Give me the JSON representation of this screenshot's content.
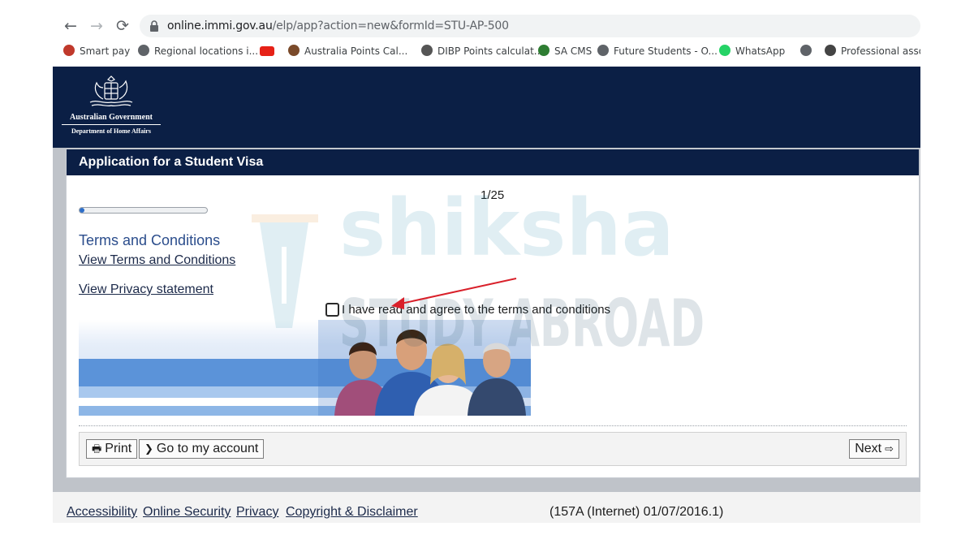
{
  "browser": {
    "url_host": "online.immi.gov.au",
    "url_rest": "/elp/app?action=new&formId=STU-AP-500",
    "back_glyph": "←",
    "forward_glyph": "→",
    "reload_glyph": "⟳",
    "bookmarks": [
      {
        "label": "Smart pay",
        "icon": "smart-pay-icon",
        "color": "#c0392b"
      },
      {
        "label": "Regional locations i...",
        "icon": "globe-icon",
        "color": "#5f6368"
      },
      {
        "label": "",
        "icon": "youtube-icon",
        "color": "#e62117"
      },
      {
        "label": "Australia Points Cal...",
        "icon": "points-calculator-icon",
        "color": "#7a4a2a"
      },
      {
        "label": "DIBP Points calculat...",
        "icon": "dibp-crest-icon",
        "color": "#555555"
      },
      {
        "label": "SA CMS",
        "icon": "sa-cms-icon",
        "color": "#2e7d32"
      },
      {
        "label": "Future Students - O...",
        "icon": "globe-icon",
        "color": "#5f6368"
      },
      {
        "label": "WhatsApp",
        "icon": "whatsapp-icon",
        "color": "#25d366"
      },
      {
        "label": "",
        "icon": "globe-icon",
        "color": "#5f6368"
      },
      {
        "label": "Professional assoc",
        "icon": "shield-crest-icon",
        "color": "#444444"
      }
    ]
  },
  "header": {
    "line1": "Australian Government",
    "line2": "Department of Home Affairs",
    "bg_color": "#0b1f45"
  },
  "form": {
    "title": "Application for a Student Visa",
    "step_label": "1/25",
    "progress_fraction": 0.04,
    "section_heading": "Terms and Conditions",
    "link_terms": "View Terms and Conditions",
    "link_privacy": "View Privacy statement",
    "agree_label": "I have read and agree to the terms and conditions",
    "agree_checked": false
  },
  "actions": {
    "print_glyph": "🖶",
    "print_label": "Print",
    "account_glyph": "❯",
    "account_label": "Go to my account",
    "next_label": "Next",
    "next_glyph": "⇨"
  },
  "footer": {
    "links": [
      "Accessibility",
      "Online Security",
      "Privacy",
      "Copyright & Disclaimer"
    ],
    "version": "(157A (Internet) 01/07/2016.1)"
  },
  "watermark": {
    "brand": "shiksha",
    "tagline": "STUDY ABROAD"
  },
  "colors": {
    "annotation_arrow": "#d9202a",
    "progress_fill": "#2d6ec8",
    "navy": "#0b1f45"
  }
}
